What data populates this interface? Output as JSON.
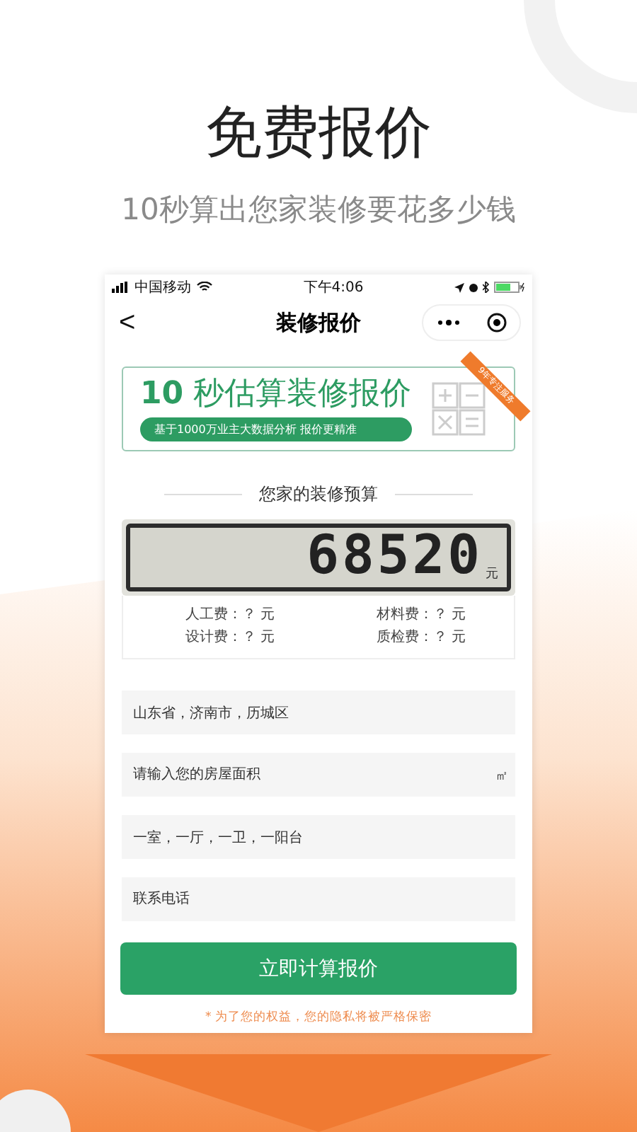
{
  "headline": "免费报价",
  "subheadline": "10秒算出您家装修要花多少钱",
  "status_bar": {
    "carrier": "中国移动",
    "time": "下午4:06"
  },
  "nav": {
    "back": "<",
    "title": "装修报价"
  },
  "banner": {
    "number": "10",
    "title": "秒估算装修报价",
    "tagline": "基于1000万业主大数据分析 报价更精准",
    "ribbon": "9年专注服务"
  },
  "budget": {
    "title": "您家的装修预算",
    "amount": "68520",
    "unit": "元"
  },
  "costs": [
    {
      "label": "人工费：",
      "value": "？ 元"
    },
    {
      "label": "材料费：",
      "value": "？ 元"
    },
    {
      "label": "设计费：",
      "value": "？ 元"
    },
    {
      "label": "质检费：",
      "value": "？ 元"
    }
  ],
  "fields": [
    {
      "kind": "value",
      "text": "山东省，济南市，历城区"
    },
    {
      "kind": "placeholder",
      "placeholder": "请输入您的房屋面积",
      "unit": "㎡"
    },
    {
      "kind": "value",
      "text": "一室，一厅，一卫，一阳台"
    },
    {
      "kind": "placeholder",
      "placeholder": "联系电话"
    }
  ],
  "submit": "立即计算报价",
  "privacy_note": "* 为了您的权益，您的隐私将被严格保密"
}
